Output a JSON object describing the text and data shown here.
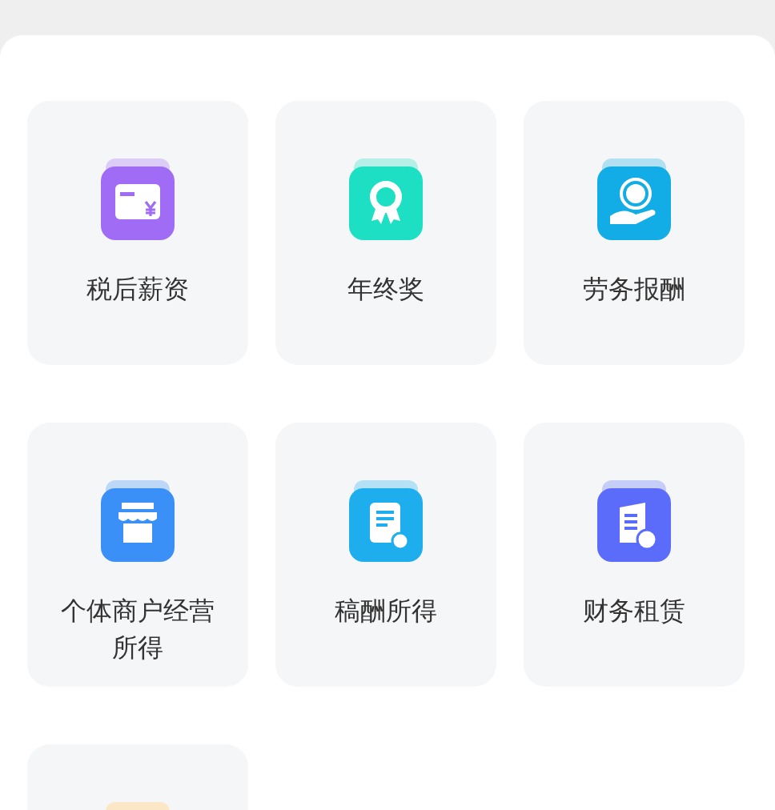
{
  "items": [
    {
      "label": "税后薪资",
      "kind": "card",
      "color": "#a06cf5"
    },
    {
      "label": "年终奖",
      "kind": "award",
      "color": "#1ddfc3"
    },
    {
      "label": "劳务报酬",
      "kind": "hand",
      "color": "#12ace6"
    },
    {
      "label": "个体商户经营所得",
      "kind": "shop",
      "color": "#3b90f8"
    },
    {
      "label": "稿酬所得",
      "kind": "doc",
      "color": "#1eaeee"
    },
    {
      "label": "财务租赁",
      "kind": "building",
      "color": "#5b6cfb"
    },
    {
      "kind": "partial"
    }
  ]
}
